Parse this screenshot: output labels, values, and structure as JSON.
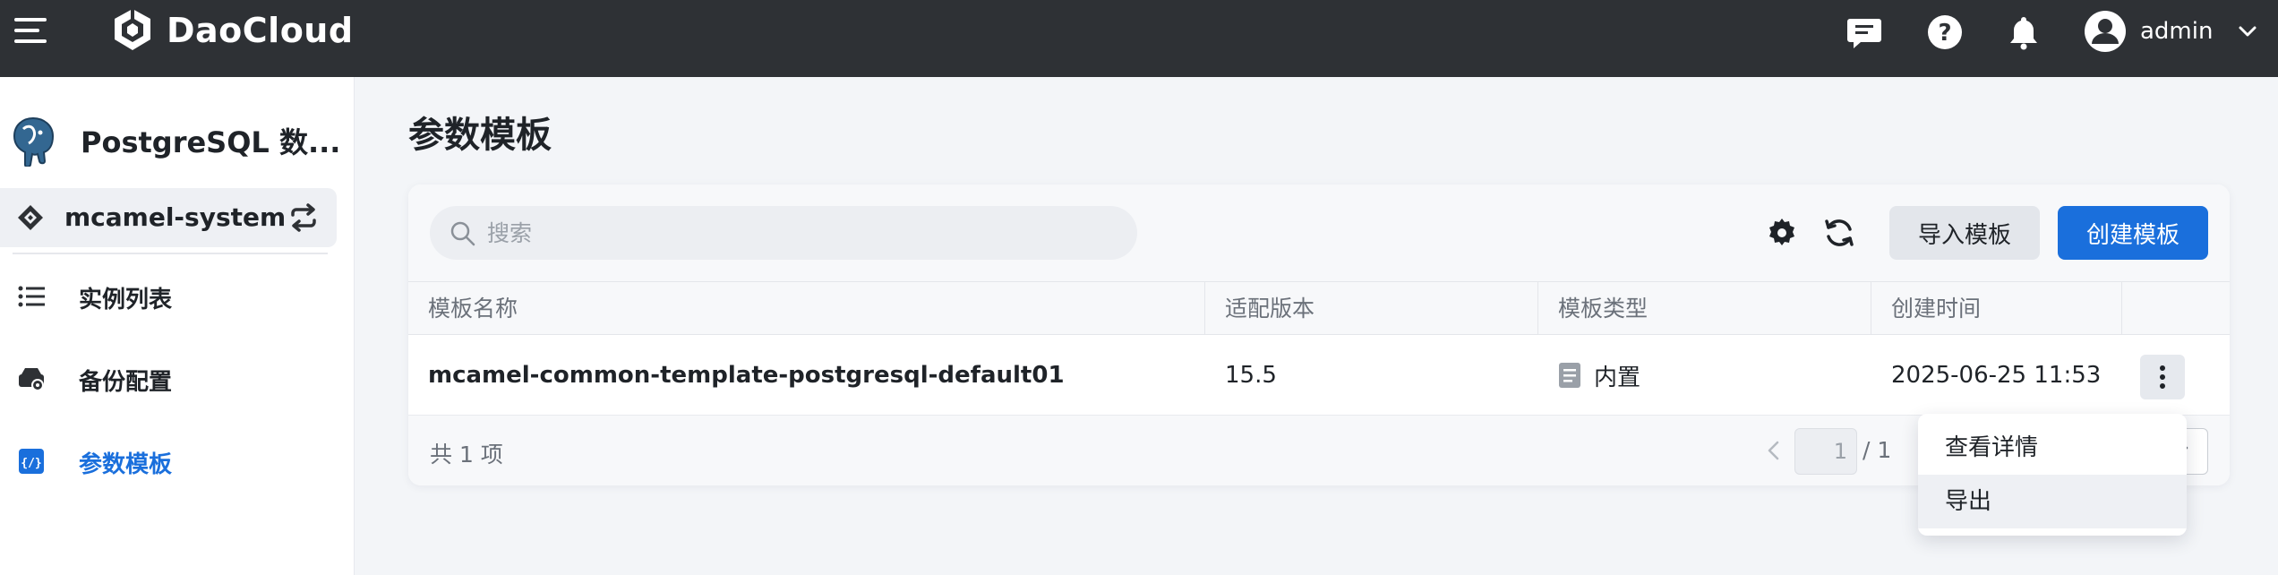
{
  "topbar": {
    "brand": "DaoCloud",
    "user": "admin",
    "icons": [
      "menu-icon",
      "chat-icon",
      "help-icon",
      "bell-icon",
      "user-avatar-icon",
      "chevron-down-icon"
    ]
  },
  "sidebar": {
    "product_name": "PostgreSQL 数...",
    "namespace": "mcamel-system",
    "items": [
      {
        "label": "实例列表",
        "icon": "list-icon",
        "active": false
      },
      {
        "label": "备份配置",
        "icon": "backup-icon",
        "active": false
      },
      {
        "label": "参数模板",
        "icon": "template-icon",
        "active": true
      }
    ]
  },
  "main": {
    "title": "参数模板",
    "search": {
      "placeholder": "搜索",
      "value": ""
    },
    "buttons": {
      "import": "导入模板",
      "create": "创建模板"
    },
    "table": {
      "columns": [
        "模板名称",
        "适配版本",
        "模板类型",
        "创建时间"
      ],
      "rows": [
        {
          "name": "mcamel-common-template-postgresql-default01",
          "version": "15.5",
          "type": "内置",
          "created": "2025-06-25 11:53"
        }
      ]
    },
    "footer": {
      "total": "共 1 项",
      "page": "1",
      "page_total": "/ 1"
    },
    "menu": [
      "查看详情",
      "导出"
    ]
  },
  "colors": {
    "topbar": "#2e3135",
    "accent": "#1a6fdc",
    "page_bg": "#f3f5f8"
  }
}
